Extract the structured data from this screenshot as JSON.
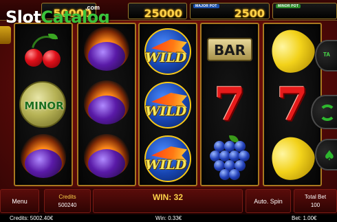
{
  "watermark": {
    "part_a": "Slot",
    "part_b": "Catalog",
    "suffix": ".com"
  },
  "jackpots": [
    {
      "label": "",
      "value": "50000",
      "color": "#1c6e1c"
    },
    {
      "label": "",
      "value": "25000",
      "color": "#b0301a"
    },
    {
      "label": "MAJOR POT",
      "value": "2500",
      "color": "#1c4fa8"
    },
    {
      "label": "MINOR POT",
      "value": "",
      "color": "#2a8a2a"
    }
  ],
  "reels": [
    [
      "cherry",
      "minor-coin",
      "plum-fire"
    ],
    [
      "plum-fire",
      "plum-fire",
      "plum-fire"
    ],
    [
      "wild",
      "wild",
      "wild"
    ],
    [
      "bar",
      "seven",
      "grapes"
    ],
    [
      "lemon",
      "seven",
      "lemon"
    ]
  ],
  "symbols": {
    "minor_text": "MINOR",
    "wild_text": "WILD",
    "bar_text": "BAR",
    "seven_text": "7"
  },
  "side": {
    "take_label": "TA",
    "spade_glyph": "♠"
  },
  "panel": {
    "menu_label": "Menu",
    "credits_label": "Credits",
    "credits_value": "500240",
    "win_text": "WIN: 32",
    "auto_spin_label": "Auto. Spin",
    "total_bet_label": "Total Bet",
    "total_bet_value": "100"
  },
  "status": {
    "credits": "Credits: 5002.40€",
    "win": "Win: 0.33€",
    "bet": "Bet: 1.00€"
  },
  "colors": {
    "accent": "#ffd24a",
    "frame": "#a8791f",
    "background": "#6a0c0a"
  }
}
